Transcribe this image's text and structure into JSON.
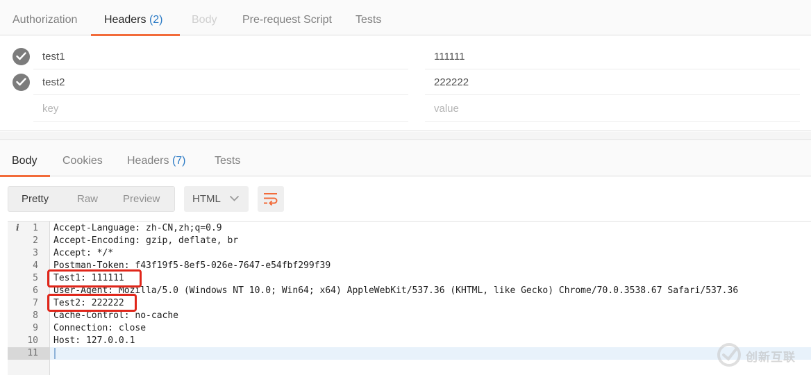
{
  "request_tabs": [
    {
      "label": "Authorization",
      "count": "",
      "state": "normal"
    },
    {
      "label": "Headers",
      "count": "(2)",
      "state": "active"
    },
    {
      "label": "Body",
      "count": "",
      "state": "disabled"
    },
    {
      "label": "Pre-request Script",
      "count": "",
      "state": "normal"
    },
    {
      "label": "Tests",
      "count": "",
      "state": "normal"
    }
  ],
  "header_rows": [
    {
      "key": "test1",
      "value": "111111",
      "enabled": true
    },
    {
      "key": "test2",
      "value": "222222",
      "enabled": true
    }
  ],
  "new_row": {
    "key_placeholder": "key",
    "value_placeholder": "value"
  },
  "response_tabs": [
    {
      "label": "Body",
      "count": "",
      "state": "active"
    },
    {
      "label": "Cookies",
      "count": "",
      "state": "normal"
    },
    {
      "label": "Headers",
      "count": "(7)",
      "state": "normal"
    },
    {
      "label": "Tests",
      "count": "",
      "state": "normal"
    }
  ],
  "view_modes": {
    "pretty": "Pretty",
    "raw": "Raw",
    "preview": "Preview",
    "selected": "Pretty"
  },
  "format": {
    "selected": "HTML"
  },
  "editor": {
    "lines": [
      {
        "num": "1",
        "text": "Accept-Language: zh-CN,zh;q=0.9"
      },
      {
        "num": "2",
        "text": "Accept-Encoding: gzip, deflate, br"
      },
      {
        "num": "3",
        "text": "Accept: */*"
      },
      {
        "num": "4",
        "text": "Postman-Token: f43f19f5-8ef5-026e-7647-e54fbf299f39"
      },
      {
        "num": "5",
        "text": "Test1: 111111"
      },
      {
        "num": "6",
        "text": "User-Agent: Mozilla/5.0 (Windows NT 10.0; Win64; x64) AppleWebKit/537.36 (KHTML, like Gecko) Chrome/70.0.3538.67 Safari/537.36"
      },
      {
        "num": "7",
        "text": "Test2: 222222"
      },
      {
        "num": "8",
        "text": "Cache-Control: no-cache"
      },
      {
        "num": "9",
        "text": "Connection: close"
      },
      {
        "num": "10",
        "text": "Host: 127.0.0.1"
      },
      {
        "num": "11",
        "text": ""
      }
    ],
    "current_line": "11",
    "info_icon": "i"
  },
  "watermark": {
    "text": "创新互联"
  },
  "colors": {
    "accent": "#f26b3a",
    "count_blue": "#2a7ac5",
    "highlight_red": "#e0261a"
  }
}
